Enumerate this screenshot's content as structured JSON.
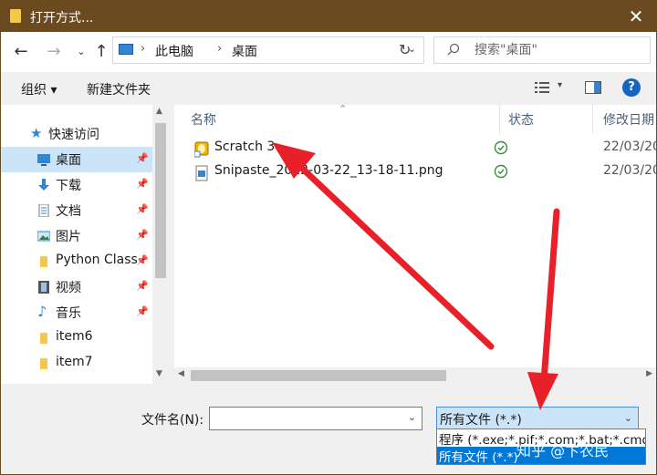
{
  "window": {
    "title": "打开方式..."
  },
  "address": {
    "segments": [
      "此电脑",
      "桌面"
    ]
  },
  "search": {
    "placeholder": "搜索\"桌面\""
  },
  "toolbar": {
    "organize": "组织 ▾",
    "new_folder": "新建文件夹"
  },
  "nav": {
    "quick_access": "快速访问",
    "items": [
      {
        "label": "桌面",
        "icon": "desktop-icon",
        "pinned": true
      },
      {
        "label": "下载",
        "icon": "download-icon",
        "pinned": true
      },
      {
        "label": "文档",
        "icon": "document-icon",
        "pinned": true
      },
      {
        "label": "图片",
        "icon": "picture-icon",
        "pinned": true
      },
      {
        "label": "Python Class",
        "icon": "folder-icon",
        "pinned": true
      },
      {
        "label": "视频",
        "icon": "video-icon",
        "pinned": true
      },
      {
        "label": "音乐",
        "icon": "music-icon",
        "pinned": true
      },
      {
        "label": "item6",
        "icon": "folder-icon",
        "pinned": false
      },
      {
        "label": "item7",
        "icon": "folder-icon",
        "pinned": false
      }
    ]
  },
  "files": {
    "columns": [
      "名称",
      "状态",
      "修改日期"
    ],
    "rows": [
      {
        "name": "Scratch 3",
        "date": "22/03/20",
        "icon": "scratch-shortcut-icon",
        "status": "synced-icon"
      },
      {
        "name": "Snipaste_2022-03-22_13-18-11.png",
        "date": "22/03/20",
        "icon": "image-file-icon",
        "status": "synced-icon"
      }
    ]
  },
  "bottom": {
    "filename_label": "文件名(N):",
    "filename_value": "",
    "filetype_selected": "所有文件 (*.*)",
    "filetype_options": [
      "程序 (*.exe;*.pif;*.com;*.bat;*.cmd)",
      "所有文件 (*.*)"
    ]
  },
  "watermark": "知乎 @卞农民",
  "colors": {
    "titlebar": "#6b4a1f",
    "selection": "#cce4f7",
    "highlight": "#0078d7",
    "arrow": "#e8202a"
  }
}
